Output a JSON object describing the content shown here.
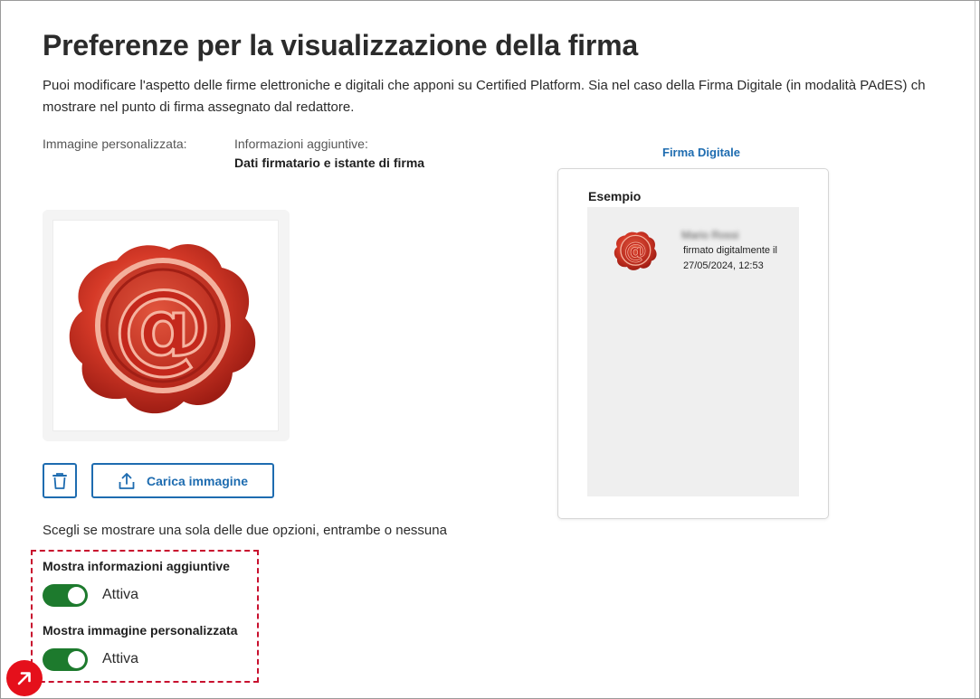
{
  "page": {
    "title": "Preferenze per la visualizzazione della firma",
    "intro_line1": "Puoi modificare l'aspetto delle firme elettroniche e digitali che apponi su Certified Platform. Sia nel caso della Firma Digitale (in modalità PAdES) ch",
    "intro_line2": "mostrare nel punto di firma assegnato dal redattore."
  },
  "custom_image": {
    "label": "Immagine personalizzata:",
    "image_icon": "wax-seal-at-icon"
  },
  "additional_info": {
    "label": "Informazioni aggiuntive:",
    "value": "Dati firmatario e istante di firma"
  },
  "buttons": {
    "delete_icon": "trash-icon",
    "upload_icon": "upload-icon",
    "upload_label": "Carica immagine"
  },
  "options": {
    "instruction": "Scegli se mostrare una sola delle due opzioni, entrambe o nessuna",
    "show_info": {
      "title": "Mostra informazioni aggiuntive",
      "state": "Attiva",
      "enabled": true
    },
    "show_image": {
      "title": "Mostra immagine personalizzata",
      "state": "Attiva",
      "enabled": true
    }
  },
  "preview": {
    "tab": "Firma Digitale",
    "title": "Esempio",
    "signer_name": "Mario Rossi",
    "line1": "firmato digitalmente il",
    "line2": "27/05/2024, 12:53"
  },
  "colors": {
    "accent": "#1e6cb0",
    "toggle_on": "#1d7a2d",
    "highlight": "#c8102e",
    "fab": "#e5101b"
  }
}
